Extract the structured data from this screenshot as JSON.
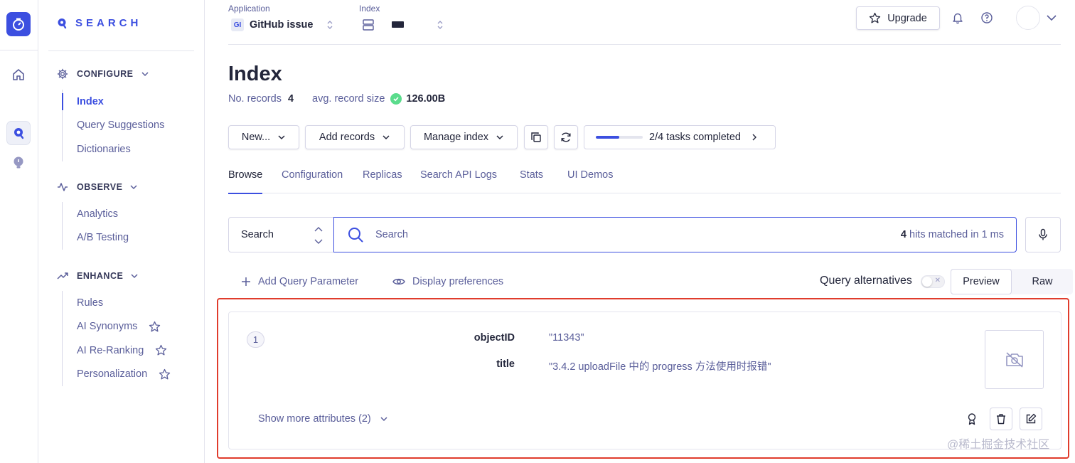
{
  "brand": {
    "name": "SEARCH"
  },
  "sidebar": {
    "sections": [
      {
        "title": "CONFIGURE",
        "items": [
          {
            "label": "Index",
            "active": true
          },
          {
            "label": "Query Suggestions"
          },
          {
            "label": "Dictionaries"
          }
        ]
      },
      {
        "title": "OBSERVE",
        "items": [
          {
            "label": "Analytics"
          },
          {
            "label": "A/B Testing"
          }
        ]
      },
      {
        "title": "ENHANCE",
        "items": [
          {
            "label": "Rules"
          },
          {
            "label": "AI Synonyms",
            "icon": "star-icon"
          },
          {
            "label": "AI Re-Ranking",
            "icon": "star-icon"
          },
          {
            "label": "Personalization",
            "icon": "star-icon"
          }
        ]
      }
    ]
  },
  "header": {
    "application_label": "Application",
    "application_badge": "GI",
    "application_value": "GitHub issue",
    "index_label": "Index",
    "upgrade_label": "Upgrade"
  },
  "page": {
    "title": "Index",
    "records_label": "No. records",
    "records_value": "4",
    "avg_size_label": "avg. record size",
    "avg_size_value": "126.00B"
  },
  "toolbar": {
    "new_label": "New...",
    "add_records_label": "Add records",
    "manage_index_label": "Manage index",
    "tasks_label": "2/4 tasks completed",
    "tasks_progress": 0.5
  },
  "tabs": [
    "Browse",
    "Configuration",
    "Replicas",
    "Search API Logs",
    "Stats",
    "UI Demos"
  ],
  "search": {
    "mode": "Search",
    "placeholder": "Search",
    "hits_count": "4",
    "hits_text": "hits matched in 1 ms"
  },
  "options": {
    "add_param_label": "Add Query Parameter",
    "display_prefs_label": "Display preferences",
    "query_alternatives_label": "Query alternatives",
    "query_alternatives_on": false,
    "view_modes": [
      "Preview",
      "Raw"
    ],
    "view_mode_active": "Preview"
  },
  "results": [
    {
      "rank": "1",
      "attributes": [
        {
          "key": "objectID",
          "value": "\"11343\""
        },
        {
          "key": "title",
          "value": "\"3.4.2 uploadFile 中的 progress 方法使用时报错\""
        }
      ],
      "show_more_label": "Show more attributes (2)"
    }
  ],
  "watermark": "@稀土掘金技术社区",
  "colors": {
    "accent": "#3c4fe0",
    "highlight": "#e03c2c",
    "success": "#5adc8c"
  }
}
